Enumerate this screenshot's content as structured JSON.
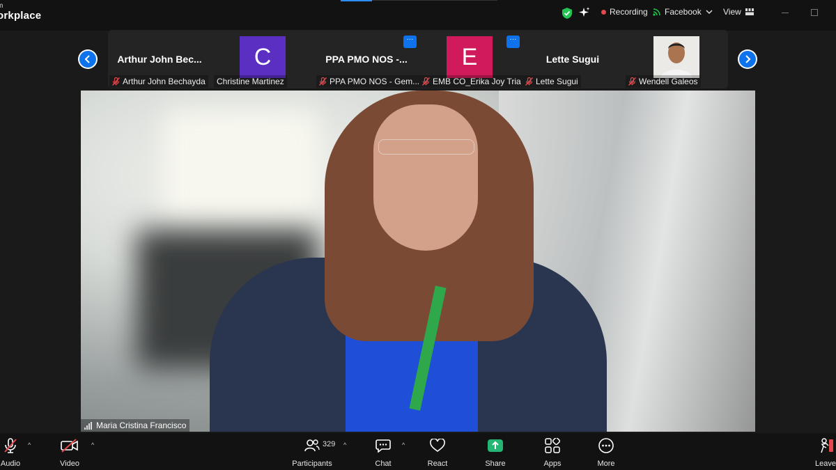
{
  "app": {
    "brand_line1": "m",
    "brand_line2": "orkplace"
  },
  "topbar": {
    "recording_label": "Recording",
    "facebook_label": "Facebook",
    "view_label": "View",
    "colors": {
      "recording_dot": "#e5484d",
      "shield": "#23c552"
    }
  },
  "strip": {
    "tiles": [
      {
        "big_name": "Arthur John Bec...",
        "label": "Arthur John Bechayda"
      },
      {
        "avatar_letter": "C",
        "avatar_color": "#5a2fc2",
        "label": "Christine Martinez"
      },
      {
        "big_name": "PPA  PMO NOS -...",
        "label": "PPA PMO NOS - Gem..."
      },
      {
        "avatar_letter": "E",
        "avatar_color": "#d01a5b",
        "label": "EMB CO_Erika Joy Tria"
      },
      {
        "big_name": "Lette Sugui",
        "label": "Lette Sugui"
      },
      {
        "label": "Wendell Galeos"
      }
    ]
  },
  "main_video": {
    "speaker_name": "Maria Cristina Francisco"
  },
  "toolbar": {
    "audio_label": "Audio",
    "video_label": "Video",
    "participants_label": "Participants",
    "participants_count": "329",
    "chat_label": "Chat",
    "react_label": "React",
    "share_label": "Share",
    "apps_label": "Apps",
    "more_label": "More",
    "leave_label": "Leave",
    "colors": {
      "share_green": "#22b573",
      "muted_red": "#e5484d"
    }
  }
}
